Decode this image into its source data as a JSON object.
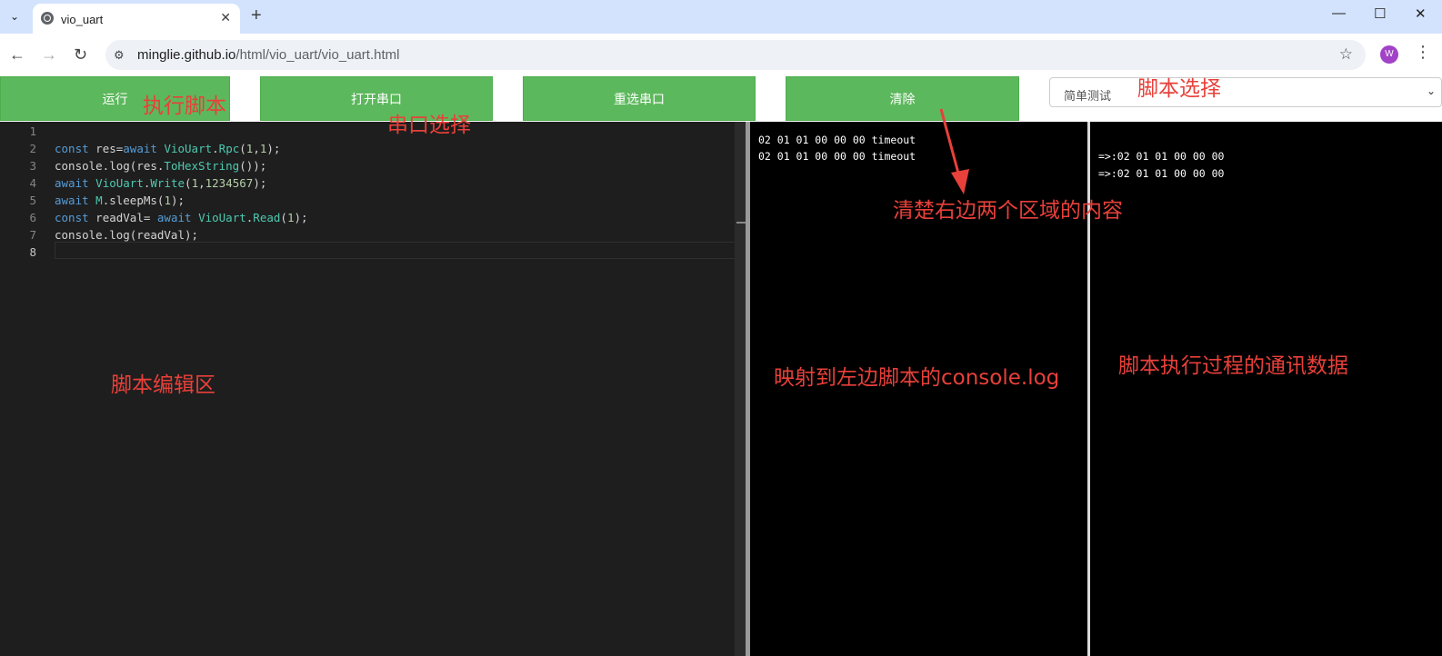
{
  "browser": {
    "tab_title": "vio_uart",
    "url_host": "minglie.github.io",
    "url_path": "/html/vio_uart/vio_uart.html",
    "profile_initial": "W"
  },
  "toolbar": {
    "run_label": "运行",
    "open_port_label": "打开串口",
    "reselect_port_label": "重选串口",
    "clear_label": "清除",
    "script_select_value": "简单测试"
  },
  "editor": {
    "line_numbers": [
      "1",
      "2",
      "3",
      "4",
      "5",
      "6",
      "7",
      "8"
    ]
  },
  "console_output": {
    "lines": [
      "02 01 01 00 00 00 timeout",
      "02 01 01 00 00 00 timeout"
    ]
  },
  "comm_output": {
    "lines": [
      "=>:02 01 01 00 00 00",
      "=>:02 01 01 00 00 00"
    ]
  },
  "annotations": {
    "run_script": "执行脚本",
    "port_select": "串口选择",
    "script_select": "脚本选择",
    "clear_right": "清楚右边两个区域的内容",
    "editor_area": "脚本编辑区",
    "console_map": "映射到左边脚本的console.log",
    "comm_data": "脚本执行过程的通讯数据"
  },
  "colors": {
    "button_green": "#5cb85c",
    "annotation_red": "#e8403a"
  }
}
